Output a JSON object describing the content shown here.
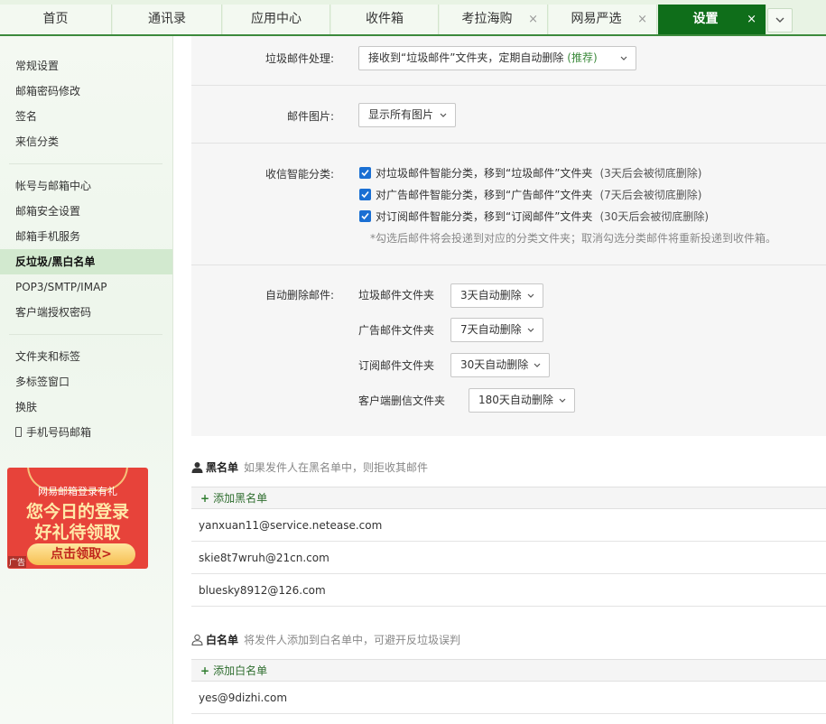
{
  "tabs": [
    {
      "label": "首页",
      "closable": false
    },
    {
      "label": "通讯录",
      "closable": false
    },
    {
      "label": "应用中心",
      "closable": false
    },
    {
      "label": "收件箱",
      "closable": false
    },
    {
      "label": "考拉海购",
      "closable": true
    },
    {
      "label": "网易严选",
      "closable": true
    },
    {
      "label": "设置",
      "closable": true,
      "active": true
    }
  ],
  "tab_close_symbol": "×",
  "sidebar": {
    "items": [
      "常规设置",
      "邮箱密码修改",
      "签名",
      "来信分类",
      "帐号与邮箱中心",
      "邮箱安全设置",
      "邮箱手机服务",
      "反垃圾/黑白名单",
      "POP3/SMTP/IMAP",
      "客户端授权密码",
      "文件夹和标签",
      "多标签窗口",
      "换肤",
      "手机号码邮箱"
    ],
    "active_item": "反垃圾/黑白名单"
  },
  "ad": {
    "line1": "网易邮箱登录有礼",
    "line2": "您今日的登录",
    "line3": "好礼待领取",
    "button": "点击领取>",
    "tag": "广告"
  },
  "spam": {
    "label": "垃圾邮件处理:",
    "value": "接收到“垃圾邮件”文件夹，定期自动删除",
    "recommend": "(推荐)"
  },
  "images": {
    "label": "邮件图片:",
    "value": "显示所有图片"
  },
  "smart": {
    "label": "收信智能分类:",
    "options": [
      {
        "text": "对垃圾邮件智能分类，移到“垃圾邮件”文件夹",
        "note": "(3天后会被彻底删除)",
        "checked": true
      },
      {
        "text": "对广告邮件智能分类，移到“广告邮件”文件夹",
        "note": "(7天后会被彻底删除)",
        "checked": true
      },
      {
        "text": "对订阅邮件智能分类，移到“订阅邮件”文件夹",
        "note": "(30天后会被彻底删除)",
        "checked": true
      }
    ],
    "hint": "*勾选后邮件将会投递到对应的分类文件夹；取消勾选分类邮件将重新投递到收件箱。"
  },
  "autodel": {
    "label": "自动删除邮件:",
    "rows": [
      {
        "folder": "垃圾邮件文件夹",
        "value": "3天自动删除"
      },
      {
        "folder": "广告邮件文件夹",
        "value": "7天自动删除"
      },
      {
        "folder": "订阅邮件文件夹",
        "value": "30天自动删除"
      },
      {
        "folder": "客户端删信文件夹",
        "value": "180天自动删除"
      }
    ]
  },
  "blacklist": {
    "title": "黑名单",
    "desc": "如果发件人在黑名单中，则拒收其邮件",
    "add": "添加黑名单",
    "emails": [
      "yanxuan11@service.netease.com",
      "skie8t7wruh@21cn.com",
      "bluesky8912@126.com"
    ]
  },
  "whitelist": {
    "title": "白名单",
    "desc": "将发件人添加到白名单中，可避开反垃圾误判",
    "add": "添加白名单",
    "emails": [
      "yes@9dizhi.com"
    ]
  },
  "plus_symbol": "+",
  "colors": {
    "accent": "#0f6e1a",
    "tabbar": "#e8f3e4",
    "checkbox": "#1a6fd3",
    "ad": "#e7433a"
  }
}
